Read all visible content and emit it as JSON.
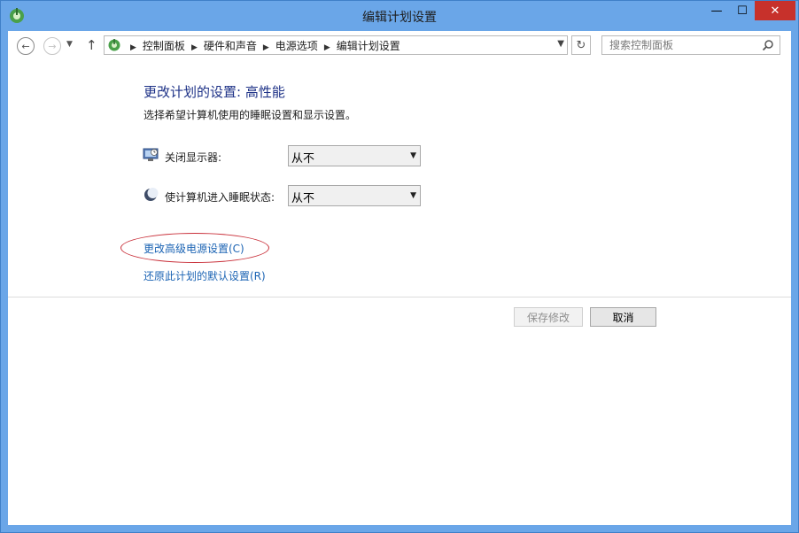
{
  "window": {
    "title": "编辑计划设置",
    "minimize_glyph": "—",
    "maximize_glyph": "☐",
    "close_glyph": "✕"
  },
  "nav": {
    "back_glyph": "←",
    "forward_glyph": "→",
    "recent_glyph": "▼",
    "up_glyph": "↑",
    "breadcrumbs": [
      "控制面板",
      "硬件和声音",
      "电源选项",
      "编辑计划设置"
    ],
    "breadcrumb_sep": "▶",
    "refresh_glyph": "↻",
    "search_placeholder": "搜索控制面板"
  },
  "content": {
    "heading": "更改计划的设置: 高性能",
    "subtitle": "选择希望计算机使用的睡眠设置和显示设置。",
    "settings": [
      {
        "label": "关闭显示器:",
        "value": "从不",
        "icon": "monitor-icon"
      },
      {
        "label": "使计算机进入睡眠状态:",
        "value": "从不",
        "icon": "moon-icon"
      }
    ],
    "advanced_link": "更改高级电源设置(C)",
    "restore_link": "还原此计划的默认设置(R)"
  },
  "buttons": {
    "save": "保存修改",
    "cancel": "取消"
  },
  "colors": {
    "title_text": "#1e1e1e",
    "heading": "#1e3287",
    "link": "#1c64b4",
    "close_button": "#c7312b",
    "annotation_oval": "#c9303a"
  }
}
